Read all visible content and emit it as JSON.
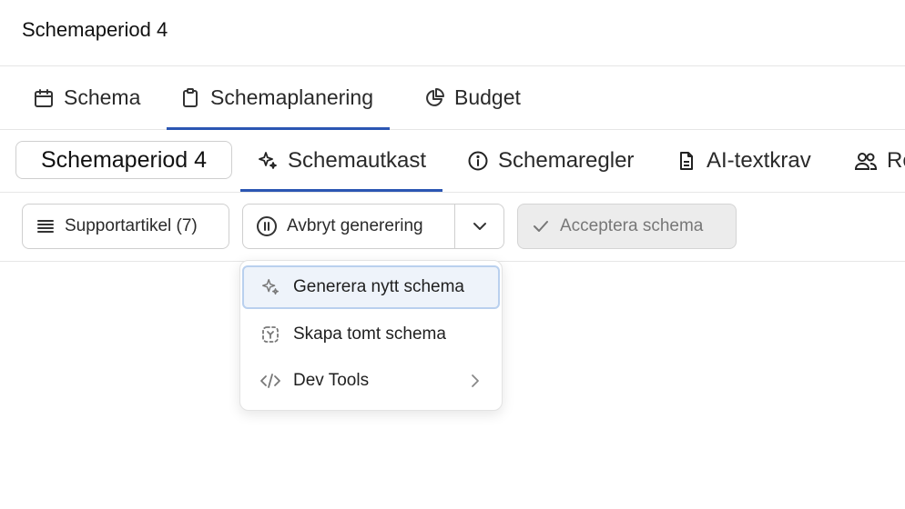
{
  "header": {
    "title": "Schemaperiod 4"
  },
  "main_tabs": [
    {
      "label": "Schema",
      "icon": "calendar-icon",
      "active": false
    },
    {
      "label": "Schemaplanering",
      "icon": "clipboard-icon",
      "active": true
    },
    {
      "label": "Budget",
      "icon": "pie-chart-icon",
      "active": false
    }
  ],
  "sub_tabs": {
    "period": "Schemaperiod 4",
    "items": [
      {
        "label": "Schemautkast",
        "icon": "sparkle-icon",
        "active": true
      },
      {
        "label": "Schemaregler",
        "icon": "info-icon",
        "active": false
      },
      {
        "label": "AI-textkrav",
        "icon": "document-icon",
        "active": false
      },
      {
        "label": "Re",
        "icon": "users-icon",
        "active": false
      }
    ]
  },
  "toolbar": {
    "support_label": "Supportartikel (7)",
    "abort_label": "Avbryt generering",
    "accept_label": "Acceptera schema"
  },
  "dropdown": {
    "items": [
      {
        "label": "Generera nytt schema",
        "icon": "sparkle-icon",
        "highlighted": true
      },
      {
        "label": "Skapa tomt schema",
        "icon": "dashed-box-icon",
        "highlighted": false
      },
      {
        "label": "Dev Tools",
        "icon": "code-icon",
        "submenu": true
      }
    ]
  },
  "colors": {
    "accent": "#2b56b3",
    "highlight_bg": "#eef3fa",
    "highlight_border": "#b9d0ee",
    "disabled_bg": "#ececec"
  }
}
